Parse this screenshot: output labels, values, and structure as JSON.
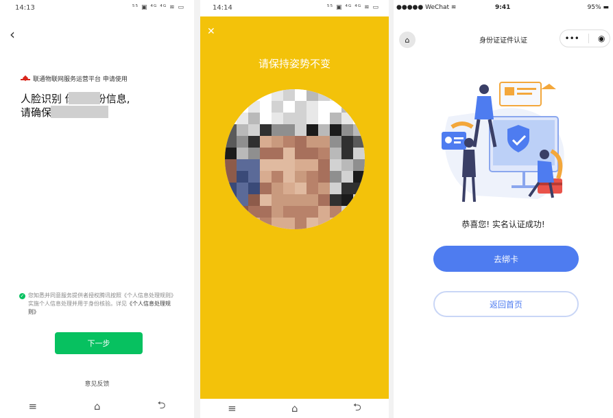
{
  "panel1": {
    "status": {
      "time": "14:13",
      "icons": "⁵⁵ ▣ ⁴ᴳ ⁴ᴳ ≋ ▭"
    },
    "back_glyph": "‹",
    "requester": "联通物联网服务运营平台 申请使用",
    "headline": "人脸识别 你的身份信息,\n请确保 人操作",
    "consent_text": "您知悉并同意服务提供者授权腾讯按照《个人信息处理规则》实施个人信息处理并用于身份核验。详见",
    "consent_link": "《个人信息处理规则》",
    "next_button": "下一步",
    "feedback": "意见反馈",
    "navbar": [
      "≡",
      "⌂",
      "⮌"
    ]
  },
  "panel2": {
    "status": {
      "time": "14:14",
      "icons": "⁵⁵ ▣ ⁴ᴳ ⁴ᴳ ≋ ▭"
    },
    "close_glyph": "✕",
    "prompt": "请保持姿势不变",
    "navbar": [
      "≡",
      "⌂",
      "⮌"
    ],
    "background_color": "#f3c20a"
  },
  "panel3": {
    "status": {
      "carrier": "●●●●● WeChat ≋",
      "time": "9:41",
      "battery": "95% ▬"
    },
    "home_glyph": "⌂",
    "title": "身份证证件认证",
    "capsule_menu": "•••",
    "capsule_close": "◉",
    "success_message": "恭喜您! 实名认证成功!",
    "primary_button": "去绑卡",
    "secondary_button": "返回首页",
    "accent_color": "#4e7cf0"
  }
}
